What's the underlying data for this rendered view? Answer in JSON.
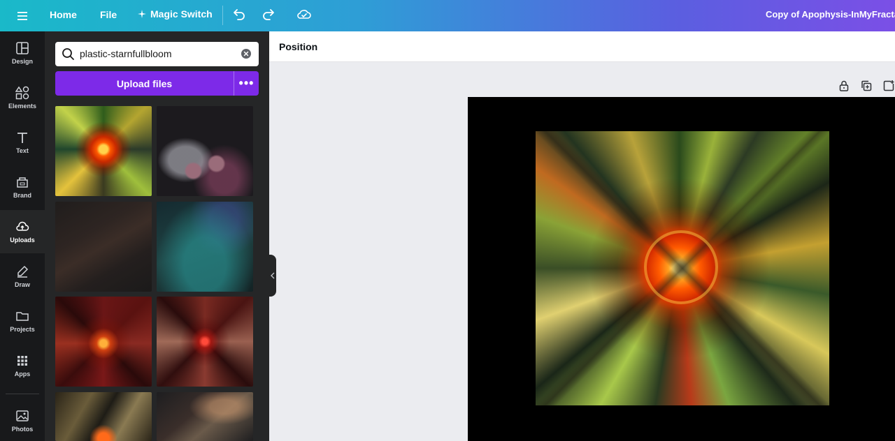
{
  "topbar": {
    "home_label": "Home",
    "file_label": "File",
    "magic_label": "Magic Switch",
    "doc_title": "Copy of Apophysis-InMyFracta"
  },
  "rail": {
    "items": [
      {
        "label": "Design",
        "icon": "layout-icon"
      },
      {
        "label": "Elements",
        "icon": "shapes-icon"
      },
      {
        "label": "Text",
        "icon": "text-icon"
      },
      {
        "label": "Brand",
        "icon": "brand-icon"
      },
      {
        "label": "Uploads",
        "icon": "cloud-upload-icon",
        "active": true
      },
      {
        "label": "Draw",
        "icon": "pen-icon"
      },
      {
        "label": "Projects",
        "icon": "folder-icon"
      },
      {
        "label": "Apps",
        "icon": "grid-icon"
      },
      {
        "label": "Photos",
        "icon": "image-icon"
      }
    ]
  },
  "panel": {
    "search_value": "plastic-starnfullbloom",
    "upload_label": "Upload files",
    "more_label": "•••"
  },
  "toolbar": {
    "position_label": "Position"
  },
  "colors": {
    "accent_purple": "#7d2ae8",
    "rail_bg": "#18191b",
    "panel_bg": "#252627"
  }
}
